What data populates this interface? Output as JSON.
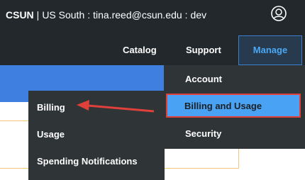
{
  "header": {
    "org": "CSUN",
    "region": "US South",
    "user": "tina.reed@csun.edu",
    "space": "dev",
    "sep_bar": "|",
    "sep_colon": ":"
  },
  "nav": {
    "catalog": "Catalog",
    "support": "Support",
    "manage": "Manage"
  },
  "manage_menu": {
    "items": [
      "Account",
      "Billing and Usage",
      "Security"
    ],
    "selected": "Billing and Usage"
  },
  "billing_submenu": {
    "items": [
      "Billing",
      "Usage",
      "Spending Notifications"
    ]
  },
  "colors": {
    "topbar": "#22282c",
    "accent": "#4aa2f5",
    "highlight_border": "#e0403a",
    "annotation_arrow": "#e0403a"
  }
}
